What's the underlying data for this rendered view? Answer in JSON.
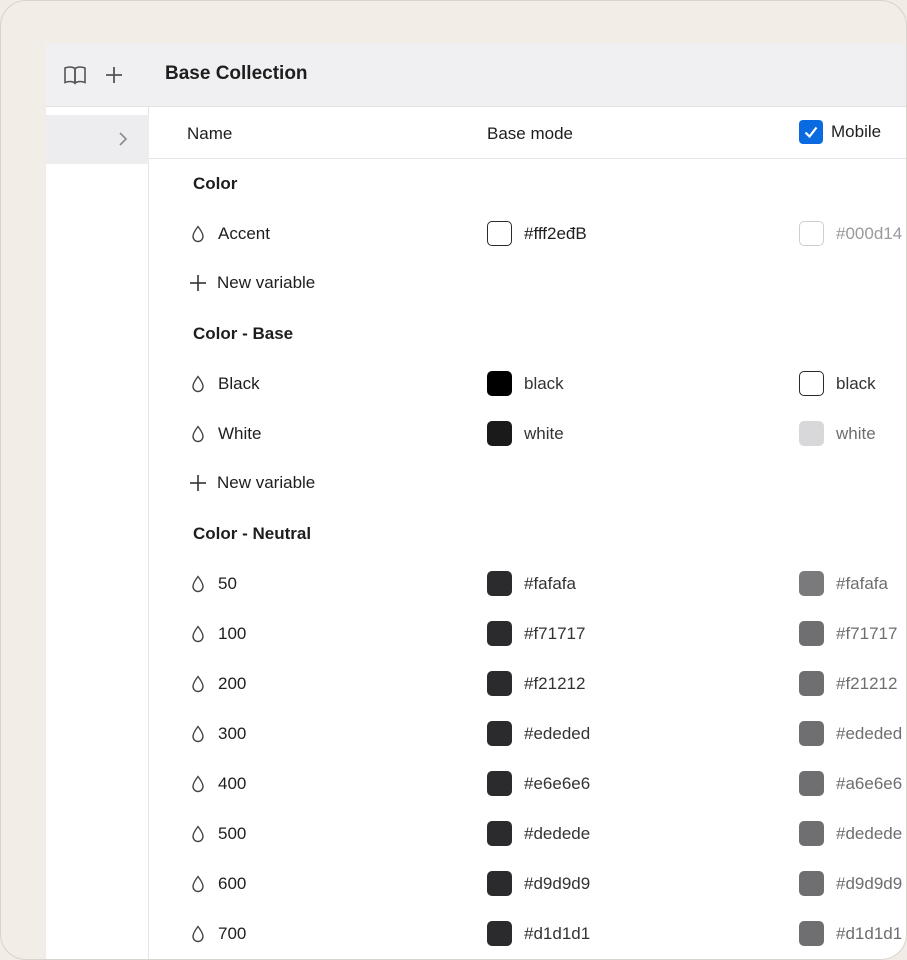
{
  "header": {
    "title": "Base Collection"
  },
  "columns": {
    "name": "Name",
    "base": "Base mode",
    "mobile": "Mobile"
  },
  "groups": [
    {
      "label": "Color",
      "variables": [
        {
          "name": "Accent",
          "base": "#fff2eđB",
          "mobile": "#000d14"
        }
      ],
      "new_label": "New variable"
    },
    {
      "label": "Color - Base",
      "variables": [
        {
          "name": "Black",
          "base": "black",
          "mobile": "black"
        },
        {
          "name": "White",
          "base": "white",
          "mobile": "white"
        }
      ],
      "new_label": "New variable"
    },
    {
      "label": "Color - Neutral",
      "variables": [
        {
          "name": "50",
          "base": "#fafafa",
          "mobile": "#fafafa"
        },
        {
          "name": "100",
          "base": "#f71717",
          "mobile": "#f71717"
        },
        {
          "name": "200",
          "base": "#f21212",
          "mobile": "#f21212"
        },
        {
          "name": "300",
          "base": "#ededed",
          "mobile": "#ededed"
        },
        {
          "name": "400",
          "base": "#e6e6e6",
          "mobile": "#a6e6e6"
        },
        {
          "name": "500",
          "base": "#dedede",
          "mobile": "#dedede"
        },
        {
          "name": "600",
          "base": "#d9d9d9",
          "mobile": "#d9d9d9"
        },
        {
          "name": "700",
          "base": "#d1d1d1",
          "mobile": "#d1d1d1"
        }
      ]
    }
  ],
  "colors": {
    "accent": "#0a6be0",
    "swatch_dark": "#2b2b2d",
    "swatch_black": "#000000",
    "swatch_mobile_grey": "#6f6f72",
    "swatch_mobile_light": "#d8d8da"
  },
  "icons": {
    "rail": [
      "book-icon",
      "plus-icon"
    ],
    "row": "chevron-right-icon",
    "variable": "drop-icon",
    "new": "plus-icon"
  }
}
